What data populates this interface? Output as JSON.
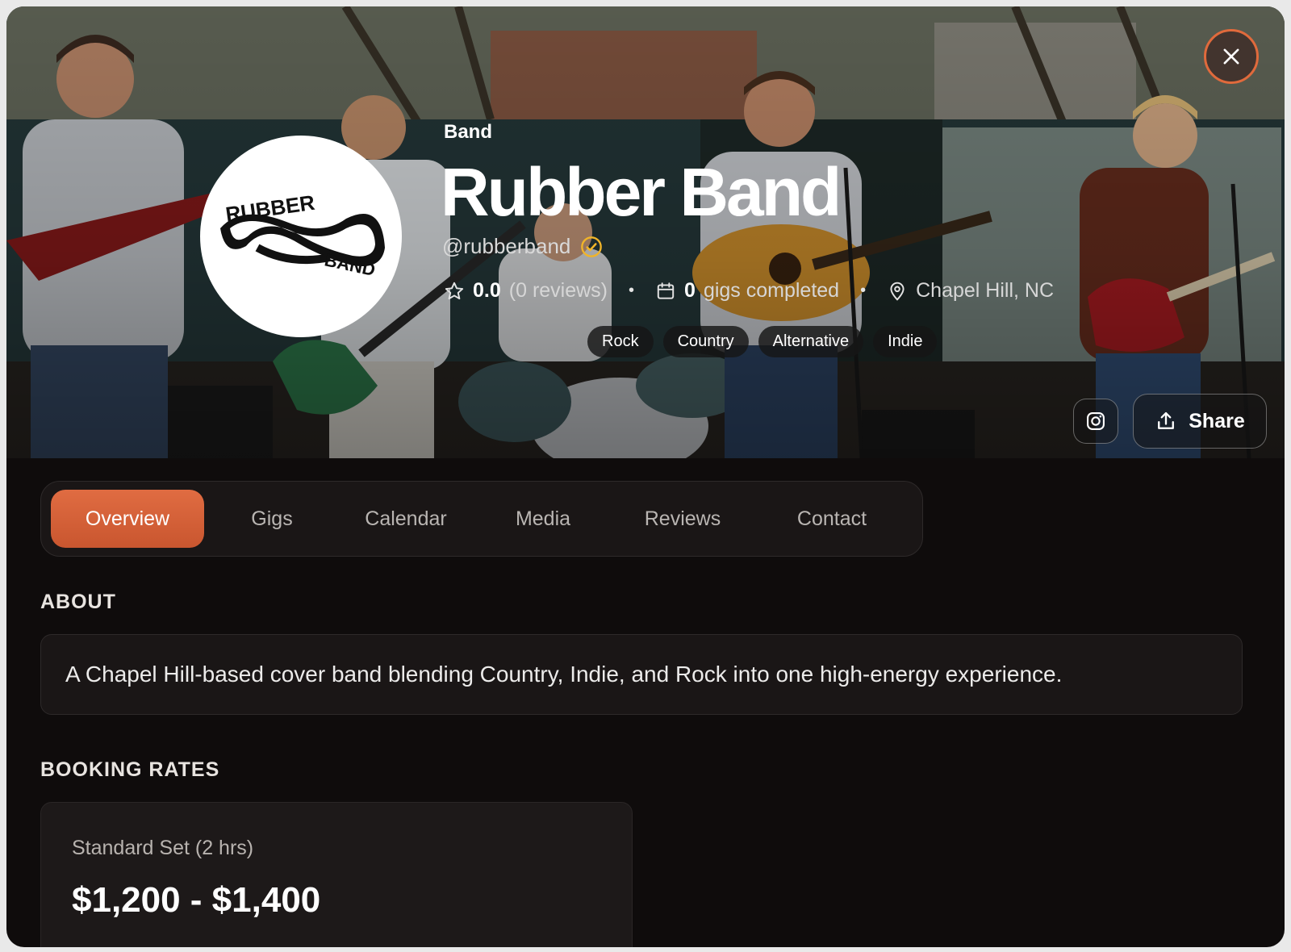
{
  "profile": {
    "type": "Band",
    "name": "Rubber Band",
    "handle": "@rubberband",
    "rating": "0.0",
    "reviews_text": "(0 reviews)",
    "gigs_count": "0",
    "gigs_text": "gigs completed",
    "location": "Chapel Hill, NC",
    "genres": [
      "Rock",
      "Country",
      "Alternative",
      "Indie"
    ],
    "logo_text": [
      "RUBBER",
      "BAND"
    ]
  },
  "actions": {
    "share_label": "Share"
  },
  "tabs": [
    "Overview",
    "Gigs",
    "Calendar",
    "Media",
    "Reviews",
    "Contact"
  ],
  "active_tab": "Overview",
  "about": {
    "heading": "ABOUT",
    "text": "A Chapel Hill-based cover band blending Country, Indie, and Rock into one high-energy experience."
  },
  "booking": {
    "heading": "BOOKING RATES",
    "rates": [
      {
        "label": "Standard Set (2 hrs)",
        "price": "$1,200 - $1,400"
      }
    ]
  },
  "colors": {
    "accent": "#e06a3c",
    "verified": "#f0b429",
    "background": "#0f0c0c"
  },
  "icons": [
    "close-icon",
    "verified-icon",
    "star-icon",
    "calendar-icon",
    "location-pin-icon",
    "instagram-icon",
    "share-icon"
  ]
}
